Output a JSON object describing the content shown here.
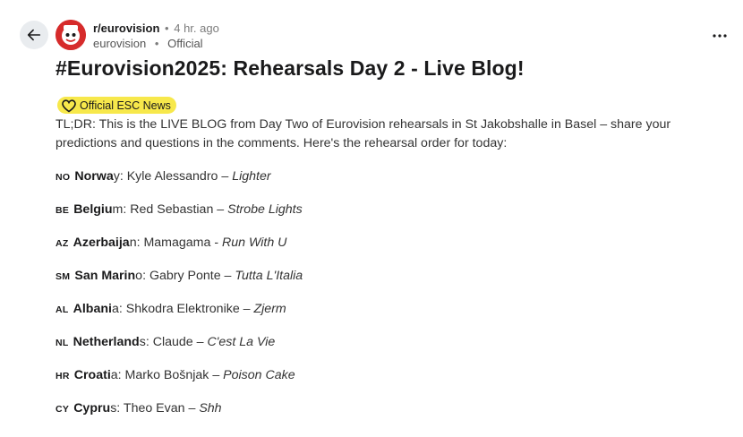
{
  "post": {
    "subreddit": "r/eurovision",
    "time_ago": "4 hr. ago",
    "author": "eurovision",
    "author_tag": "Official",
    "title": "#Eurovision2025: Rehearsals Day 2 - Live Blog!",
    "flair": "Official ESC News",
    "intro": "TL;DR: This is the LIVE BLOG from Day Two of Eurovision rehearsals in St Jakobshalle in Basel – share your predictions and questions in the comments. Here's the rehearsal order for today:"
  },
  "entries": [
    {
      "code": "NO",
      "country": "Norwa",
      "country_tail": "y",
      "artist": ": Kyle Alessandro – ",
      "song": "Lighter"
    },
    {
      "code": "BE",
      "country": "Belgiu",
      "country_tail": "m",
      "artist": ": Red Sebastian – ",
      "song": "Strobe Lights"
    },
    {
      "code": "AZ",
      "country": "Azerbaija",
      "country_tail": "n",
      "artist": ": Mamagama - ",
      "song": "Run With U"
    },
    {
      "code": "SM",
      "country": "San Marin",
      "country_tail": "o",
      "artist": ": Gabry Ponte – ",
      "song": "Tutta L'Italia"
    },
    {
      "code": "AL",
      "country": "Albani",
      "country_tail": "a",
      "artist": ": Shkodra Elektronike – ",
      "song": "Zjerm"
    },
    {
      "code": "NL",
      "country": "Netherland",
      "country_tail": "s",
      "artist": ": Claude – ",
      "song": "C'est La Vie"
    },
    {
      "code": "HR",
      "country": "Croati",
      "country_tail": "a",
      "artist": ": Marko Bošnjak – ",
      "song": "Poison Cake"
    },
    {
      "code": "CY",
      "country": "Cypru",
      "country_tail": "s",
      "artist": ": Theo Evan – ",
      "song": "Shh"
    }
  ],
  "icons": {
    "back": "back-arrow-icon",
    "more": "more-options-icon",
    "flair": "heart-icon"
  },
  "colors": {
    "flair_bg": "#f7e84b",
    "avatar_bg": "#d62b2b",
    "back_bg": "#e9ecef"
  }
}
